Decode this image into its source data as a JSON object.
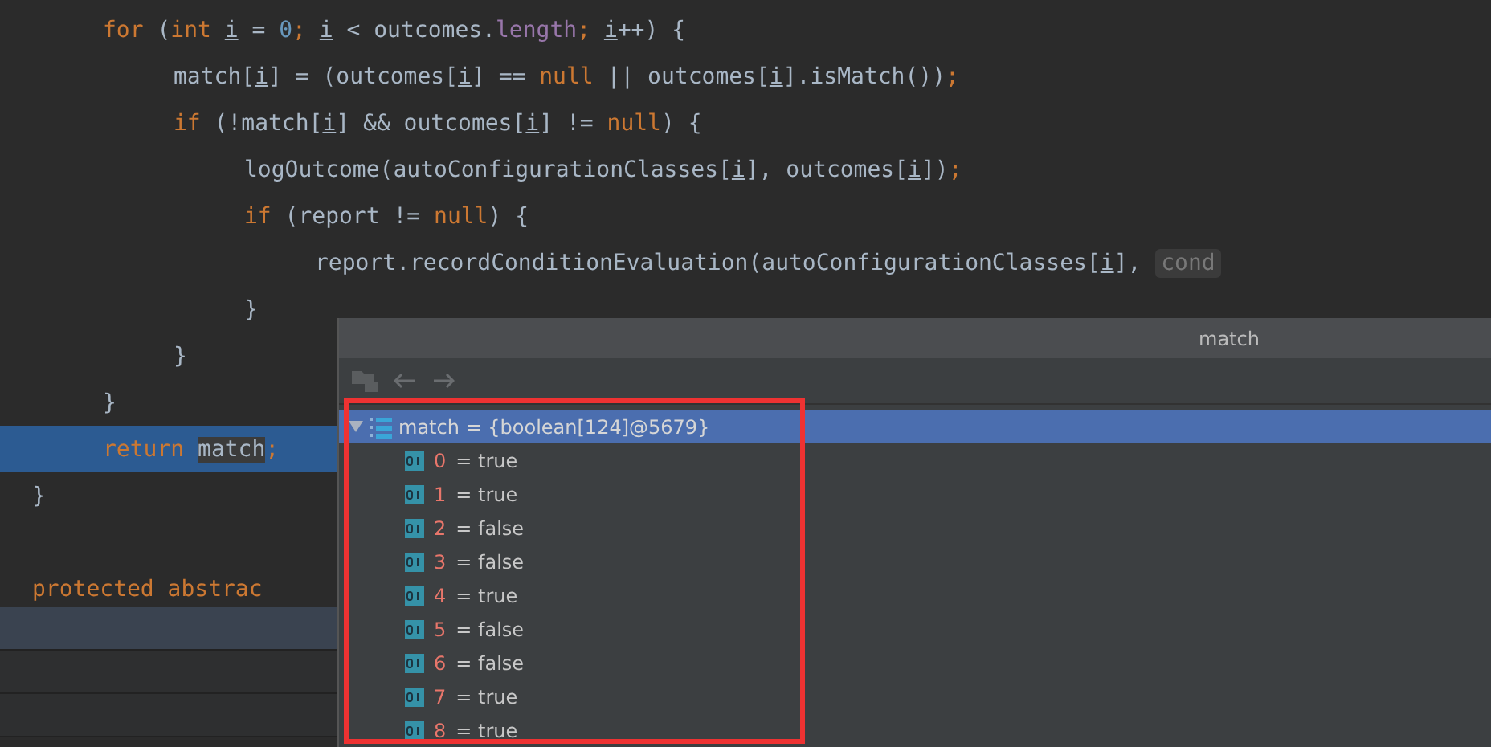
{
  "editor": {
    "body": [
      {
        "selected": false,
        "tokens": [
          {
            "kind": "keyword",
            "text": "for"
          },
          {
            "kind": "plain",
            "text": " ("
          },
          {
            "kind": "keyword",
            "text": "int "
          },
          {
            "kind": "var",
            "text": "i"
          },
          {
            "kind": "plain",
            "text": " = "
          },
          {
            "kind": "number",
            "text": "0"
          },
          {
            "kind": "keyword",
            "text": "; "
          },
          {
            "kind": "var",
            "text": "i"
          },
          {
            "kind": "plain",
            "text": " < outcomes."
          },
          {
            "kind": "field",
            "text": "length"
          },
          {
            "kind": "keyword",
            "text": "; "
          },
          {
            "kind": "var",
            "text": "i"
          },
          {
            "kind": "plain",
            "text": "++) {"
          }
        ],
        "children": [
          {
            "selected": false,
            "tokens": [
              {
                "kind": "plain",
                "text": "match["
              },
              {
                "kind": "var",
                "text": "i"
              },
              {
                "kind": "plain",
                "text": "] = (outcomes["
              },
              {
                "kind": "var",
                "text": "i"
              },
              {
                "kind": "plain",
                "text": "] == "
              },
              {
                "kind": "keyword",
                "text": "null"
              },
              {
                "kind": "plain",
                "text": " || outcomes["
              },
              {
                "kind": "var",
                "text": "i"
              },
              {
                "kind": "plain",
                "text": "].isMatch())"
              },
              {
                "kind": "keyword",
                "text": ";"
              }
            ]
          },
          {
            "selected": false,
            "tokens": [
              {
                "kind": "keyword",
                "text": "if"
              },
              {
                "kind": "plain",
                "text": " (!match["
              },
              {
                "kind": "var",
                "text": "i"
              },
              {
                "kind": "plain",
                "text": "] && outcomes["
              },
              {
                "kind": "var",
                "text": "i"
              },
              {
                "kind": "plain",
                "text": "] != "
              },
              {
                "kind": "keyword",
                "text": "null"
              },
              {
                "kind": "plain",
                "text": ") {"
              }
            ],
            "children": [
              {
                "selected": false,
                "tokens": [
                  {
                    "kind": "plain",
                    "text": "logOutcome(autoConfigurationClasses["
                  },
                  {
                    "kind": "var",
                    "text": "i"
                  },
                  {
                    "kind": "plain",
                    "text": "], outcomes["
                  },
                  {
                    "kind": "var",
                    "text": "i"
                  },
                  {
                    "kind": "plain",
                    "text": "])"
                  },
                  {
                    "kind": "keyword",
                    "text": ";"
                  }
                ]
              },
              {
                "selected": false,
                "tokens": [
                  {
                    "kind": "keyword",
                    "text": "if"
                  },
                  {
                    "kind": "plain",
                    "text": " (report != "
                  },
                  {
                    "kind": "keyword",
                    "text": "null"
                  },
                  {
                    "kind": "plain",
                    "text": ") {"
                  }
                ],
                "children": [
                  {
                    "selected": false,
                    "tokens": [
                      {
                        "kind": "plain",
                        "text": "report.recordConditionEvaluation(autoConfigurationClasses["
                      },
                      {
                        "kind": "var",
                        "text": "i"
                      },
                      {
                        "kind": "plain",
                        "text": "], "
                      },
                      {
                        "kind": "hint",
                        "text": "cond"
                      }
                    ]
                  }
                ]
              },
              {
                "selected": false,
                "tokens": [
                  {
                    "kind": "plain",
                    "text": "}"
                  }
                ]
              }
            ]
          },
          {
            "selected": false,
            "tokens": [
              {
                "kind": "plain",
                "text": "}"
              }
            ]
          }
        ]
      },
      {
        "selected": false,
        "tokens": [
          {
            "kind": "plain",
            "text": "}"
          }
        ]
      },
      {
        "selected": true,
        "tokens": [
          {
            "kind": "keyword",
            "text": "return "
          },
          {
            "kind": "match",
            "text": "match"
          },
          {
            "kind": "keyword",
            "text": ";"
          }
        ]
      }
    ],
    "tail": [
      {
        "selected": false,
        "tokens": [
          {
            "kind": "plain",
            "text": "}"
          }
        ]
      }
    ],
    "declarations": [
      {
        "selected": false,
        "tokens": [
          {
            "kind": "keyword",
            "text": "protected abstrac"
          }
        ]
      }
    ]
  },
  "popup": {
    "title": "match",
    "tree": {
      "label": "match = {boolean[124]@5679}",
      "expanded": true,
      "selected": true,
      "children": [
        {
          "index": "0",
          "value": "= true"
        },
        {
          "index": "1",
          "value": "= true"
        },
        {
          "index": "2",
          "value": "= false"
        },
        {
          "index": "3",
          "value": "= false"
        },
        {
          "index": "4",
          "value": "= true"
        },
        {
          "index": "5",
          "value": "= false"
        },
        {
          "index": "6",
          "value": "= false"
        },
        {
          "index": "7",
          "value": "= true"
        },
        {
          "index": "8",
          "value": "= true"
        }
      ]
    }
  }
}
